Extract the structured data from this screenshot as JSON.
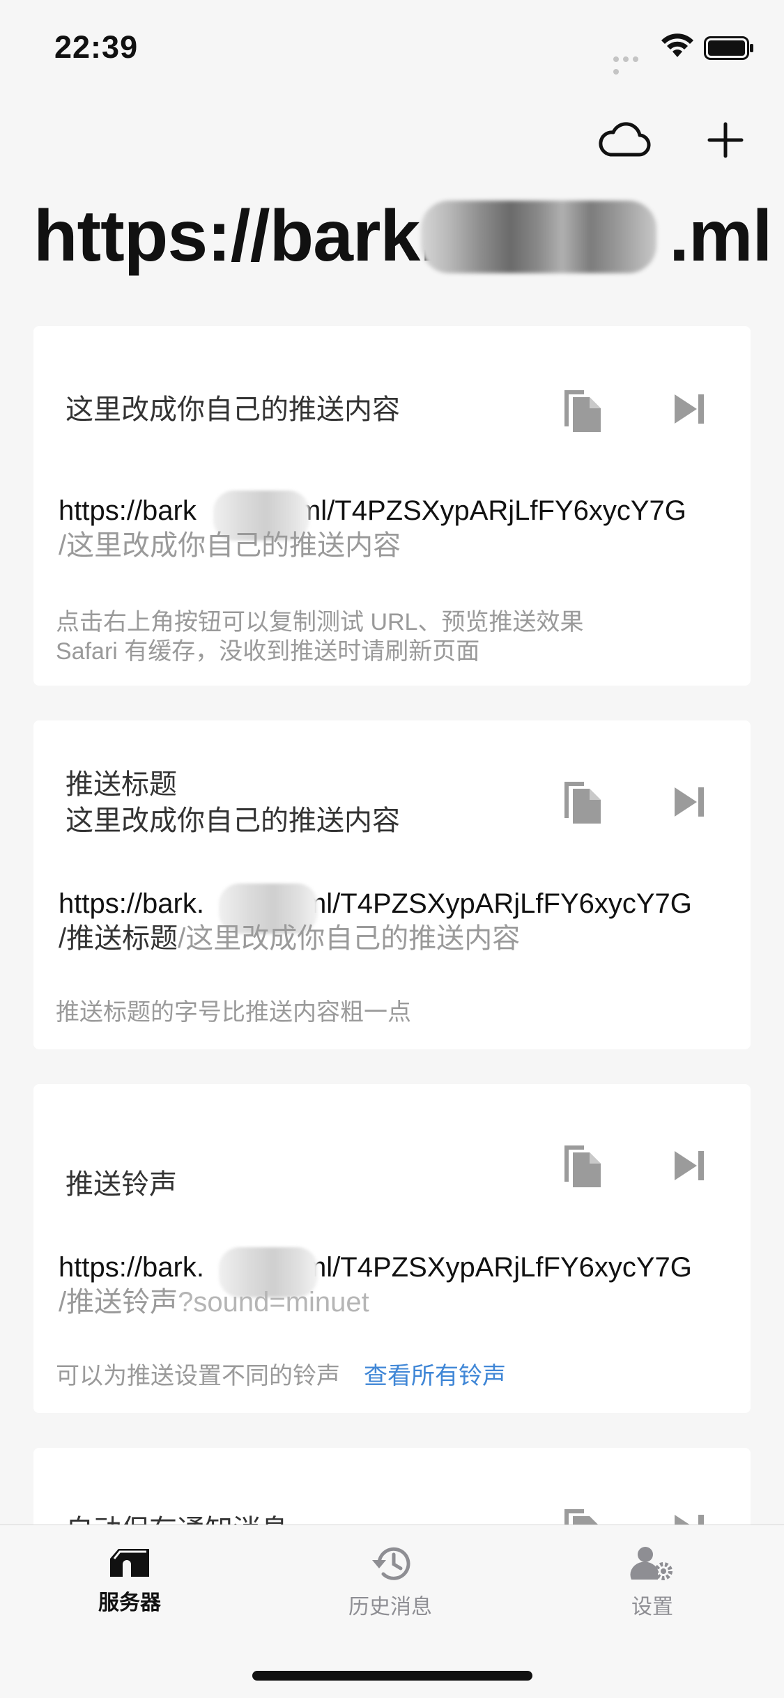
{
  "status_bar": {
    "time": "22:39"
  },
  "header": {
    "title_prefix": "https://bark.",
    "title_suffix": ".ml",
    "cloud_icon": "cloud-icon",
    "add_icon": "plus-icon"
  },
  "cards": [
    {
      "title": "这里改成你自己的推送内容",
      "url_host_prefix": "https://bark",
      "url_path": ".ml/T4PZSXypARjLfFY6xycY7G",
      "url_sub_dark": "",
      "url_sub_light": "/这里改成你自己的推送内容",
      "hint_1": "点击右上角按钮可以复制测试 URL、预览推送效果",
      "hint_2": "Safari 有缓存，没收到推送时请刷新页面"
    },
    {
      "title_1": "推送标题",
      "title_2": "这里改成你自己的推送内容",
      "url_host_prefix": "https://bark.",
      "url_path": "ml/T4PZSXypARjLfFY6xycY7G",
      "url_sub_dark": "/推送标题",
      "url_sub_light": "/这里改成你自己的推送内容",
      "hint_1": "推送标题的字号比推送内容粗一点"
    },
    {
      "title": "推送铃声",
      "url_host_prefix": "https://bark.",
      "url_path": "ml/T4PZSXypARjLfFY6xycY7G",
      "url_sub_dark": "/推送铃声",
      "url_sub_light": "?sound=minuet",
      "hint_1": "可以为推送设置不同的铃声",
      "hint_link": "查看所有铃声"
    },
    {
      "title": "自动保存通知消息"
    }
  ],
  "tabs": [
    {
      "label": "服务器",
      "icon": "server-icon",
      "active": true
    },
    {
      "label": "历史消息",
      "icon": "history-icon",
      "active": false
    },
    {
      "label": "设置",
      "icon": "settings-icon",
      "active": false
    }
  ],
  "colors": {
    "background": "#f6f6f6",
    "card": "#ffffff",
    "icon_gray": "#9b9b9b",
    "link_blue": "#3f86d6",
    "tab_inactive": "#8e8e93",
    "tab_active": "#111111"
  }
}
